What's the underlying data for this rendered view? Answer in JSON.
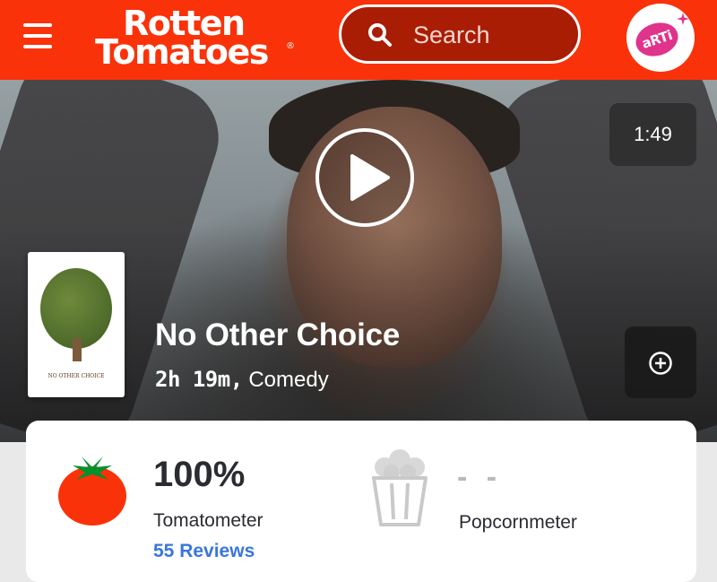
{
  "header": {
    "logo_line1": "Rotten",
    "logo_line2": "Tomatoes",
    "logo_reg": "®",
    "search_placeholder": "Search",
    "avatar_text": "aRTi"
  },
  "hero": {
    "video_duration": "1:49",
    "poster_title": "NO OTHER CHOICE",
    "title": "No Other Choice",
    "runtime": "2h 19m,",
    "genre": "Comedy"
  },
  "scores": {
    "tomatometer_value": "100%",
    "tomatometer_label": "Tomatometer",
    "reviews_link": "55 Reviews",
    "popcornmeter_value": "- -",
    "popcornmeter_label": "Popcornmeter"
  },
  "colors": {
    "brand_red": "#fa320a",
    "link_blue": "#3976dc"
  },
  "icons": [
    "menu-icon",
    "search-icon",
    "play-icon",
    "plus-icon",
    "tomato-icon",
    "popcorn-icon"
  ]
}
